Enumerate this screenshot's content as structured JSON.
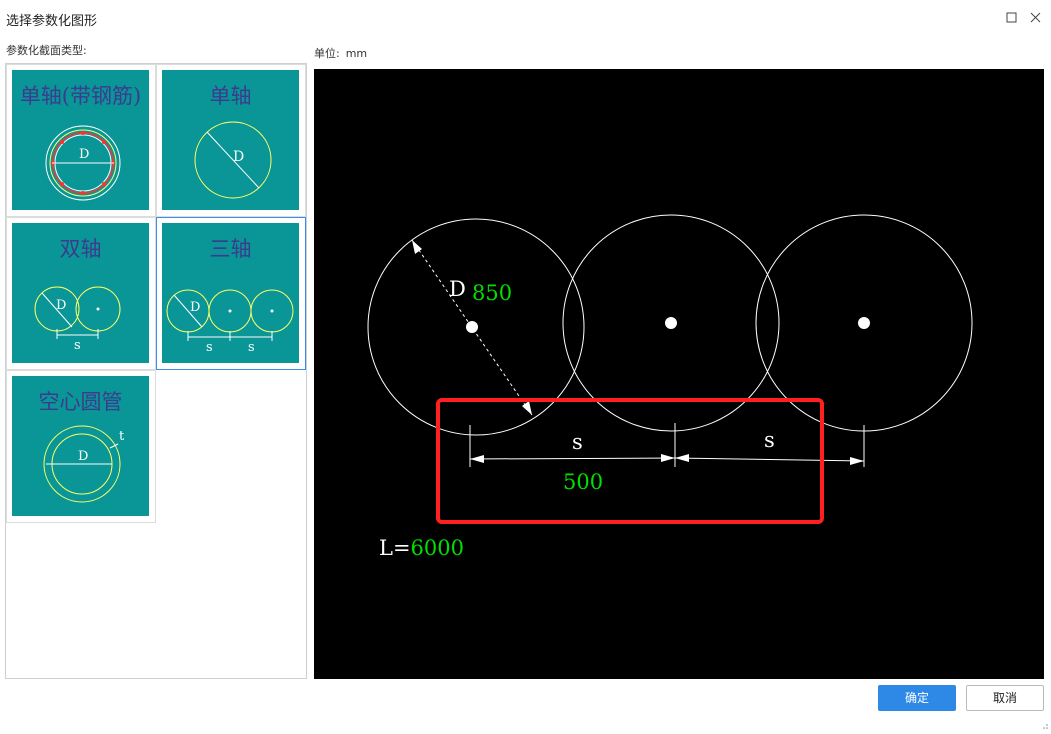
{
  "window": {
    "title": "选择参数化图形"
  },
  "labels": {
    "section_type": "参数化截面类型:",
    "unit_label": "单位:",
    "unit_value": "mm"
  },
  "shapes": [
    {
      "title": "单轴(带钢筋)",
      "dim": "D"
    },
    {
      "title": "单轴",
      "dim": "D"
    },
    {
      "title": "双轴",
      "dim": "D",
      "spacing": "s"
    },
    {
      "title": "三轴",
      "dim": "D",
      "spacing": "s",
      "selected": true
    },
    {
      "title": "空心圆管",
      "dim": "D",
      "thickness": "t"
    }
  ],
  "preview": {
    "diameter_label": "D",
    "diameter_value": "850",
    "spacing_label": "s",
    "spacing_value": "500",
    "length_label": "L=",
    "length_value": "6000"
  },
  "buttons": {
    "ok": "确定",
    "cancel": "取消"
  },
  "colors": {
    "thumb_bg": "#0a9696",
    "thumb_title": "#3b3b8f",
    "accent": "#2d88e6",
    "value_green": "#00e000",
    "highlight_red": "#ff2020"
  }
}
